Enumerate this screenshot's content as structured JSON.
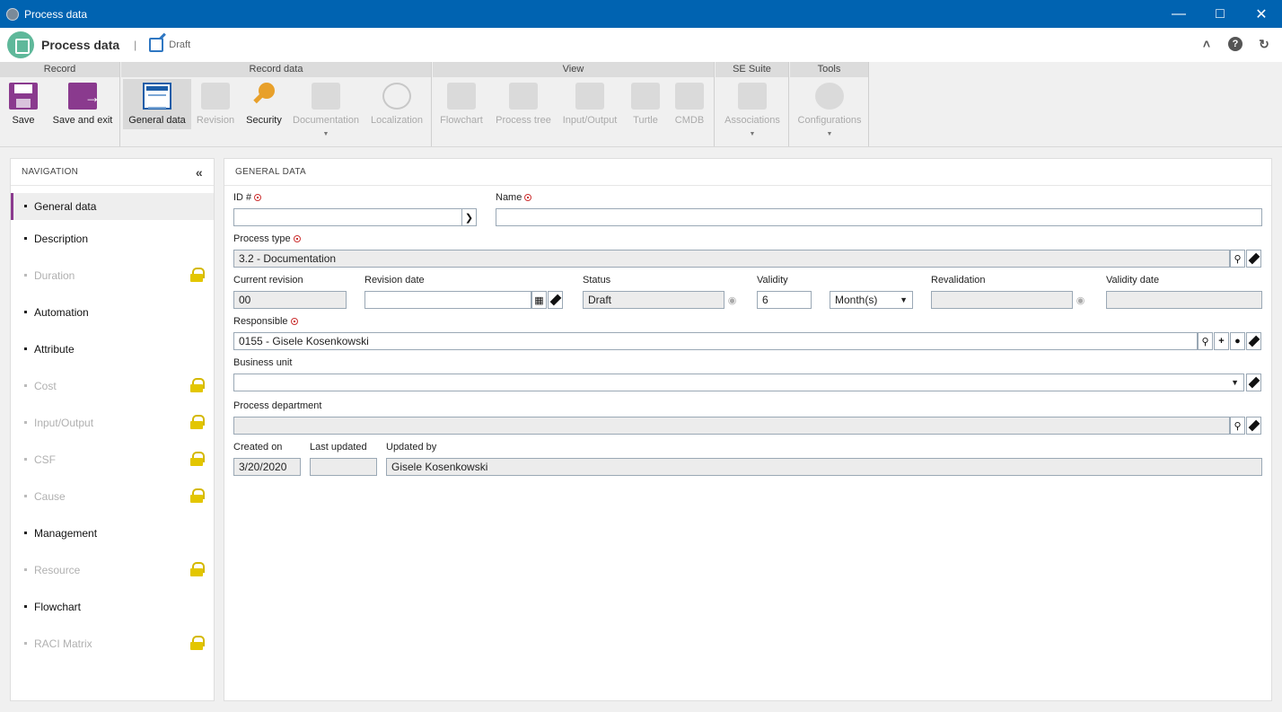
{
  "window": {
    "title": "Process data"
  },
  "header": {
    "title": "Process data",
    "status": "Draft"
  },
  "ribbon": {
    "groups": [
      {
        "title": "Record"
      },
      {
        "title": "Record data"
      },
      {
        "title": "View"
      },
      {
        "title": "SE Suite"
      },
      {
        "title": "Tools"
      }
    ],
    "buttons": {
      "save": "Save",
      "save_exit": "Save and exit",
      "general_data": "General data",
      "revision": "Revision",
      "security": "Security",
      "documentation": "Documentation",
      "localization": "Localization",
      "flowchart": "Flowchart",
      "process_tree": "Process tree",
      "input_output": "Input/Output",
      "turtle": "Turtle",
      "cmdb": "CMDB",
      "associations": "Associations",
      "configurations": "Configurations"
    }
  },
  "nav": {
    "title": "NAVIGATION",
    "items": [
      {
        "label": "General data"
      },
      {
        "label": "Description"
      },
      {
        "label": "Duration"
      },
      {
        "label": "Automation"
      },
      {
        "label": "Attribute"
      },
      {
        "label": "Cost"
      },
      {
        "label": "Input/Output"
      },
      {
        "label": "CSF"
      },
      {
        "label": "Cause"
      },
      {
        "label": "Management"
      },
      {
        "label": "Resource"
      },
      {
        "label": "Flowchart"
      },
      {
        "label": "RACI Matrix"
      }
    ]
  },
  "form": {
    "section_title": "GENERAL DATA",
    "id_label": "ID #",
    "id_value": "",
    "name_label": "Name",
    "name_value": "",
    "process_type_label": "Process type",
    "process_type_value": "3.2 - Documentation",
    "current_revision_label": "Current revision",
    "current_revision_value": "00",
    "revision_date_label": "Revision date",
    "revision_date_value": "",
    "status_label": "Status",
    "status_value": "Draft",
    "validity_label": "Validity",
    "validity_value": "6",
    "validity_unit": "Month(s)",
    "revalidation_label": "Revalidation",
    "revalidation_value": "",
    "validity_date_label": "Validity date",
    "validity_date_value": "",
    "responsible_label": "Responsible",
    "responsible_value": "0155 - Gisele Kosenkowski",
    "business_unit_label": "Business unit",
    "business_unit_value": "",
    "process_department_label": "Process department",
    "process_department_value": "",
    "created_on_label": "Created on",
    "created_on_value": "3/20/2020",
    "last_updated_label": "Last updated",
    "last_updated_value": "",
    "updated_by_label": "Updated by",
    "updated_by_value": "Gisele Kosenkowski"
  }
}
